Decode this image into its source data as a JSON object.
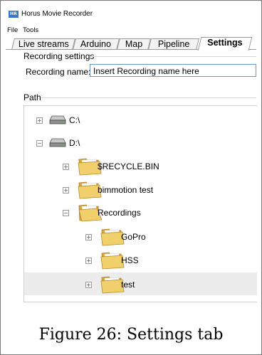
{
  "window": {
    "title": "Horus Movie Recorder",
    "icon_text": "HR"
  },
  "menu": {
    "items": [
      "File",
      "Tools"
    ]
  },
  "tabs": [
    {
      "label": "Live streams",
      "active": false
    },
    {
      "label": "Arduino",
      "active": false
    },
    {
      "label": "Map",
      "active": false
    },
    {
      "label": "Pipeline",
      "active": false
    },
    {
      "label": "Settings",
      "active": true
    }
  ],
  "recording": {
    "group_label": "Recording settings",
    "name_label": "Recording name:",
    "name_value": "Insert Recording name here"
  },
  "path": {
    "group_label": "Path",
    "tree": [
      {
        "label": "C:\\",
        "icon": "hard-drive-icon",
        "level": 0,
        "expander": "+",
        "selected": false
      },
      {
        "label": "D:\\",
        "icon": "hard-drive-icon",
        "level": 0,
        "expander": "−",
        "selected": false
      },
      {
        "label": "$RECYCLE.BIN",
        "icon": "folder-icon",
        "level": 1,
        "expander": "+",
        "selected": false
      },
      {
        "label": "bimmotion test",
        "icon": "folder-icon",
        "level": 1,
        "expander": "+",
        "selected": false
      },
      {
        "label": "Recordings",
        "icon": "folder-open-icon",
        "level": 1,
        "expander": "−",
        "selected": false
      },
      {
        "label": "GoPro",
        "icon": "folder-icon",
        "level": 2,
        "expander": "+",
        "selected": false
      },
      {
        "label": "HSS",
        "icon": "folder-icon",
        "level": 2,
        "expander": "+",
        "selected": false
      },
      {
        "label": "test",
        "icon": "folder-icon",
        "level": 2,
        "expander": "+",
        "selected": true
      }
    ]
  },
  "colors": {
    "accent": "#3a77c9",
    "folder": "#f1cf6b",
    "folder_dark": "#d8a93c",
    "selected_row": "#ececec"
  },
  "caption": "Figure 26: Settings tab"
}
